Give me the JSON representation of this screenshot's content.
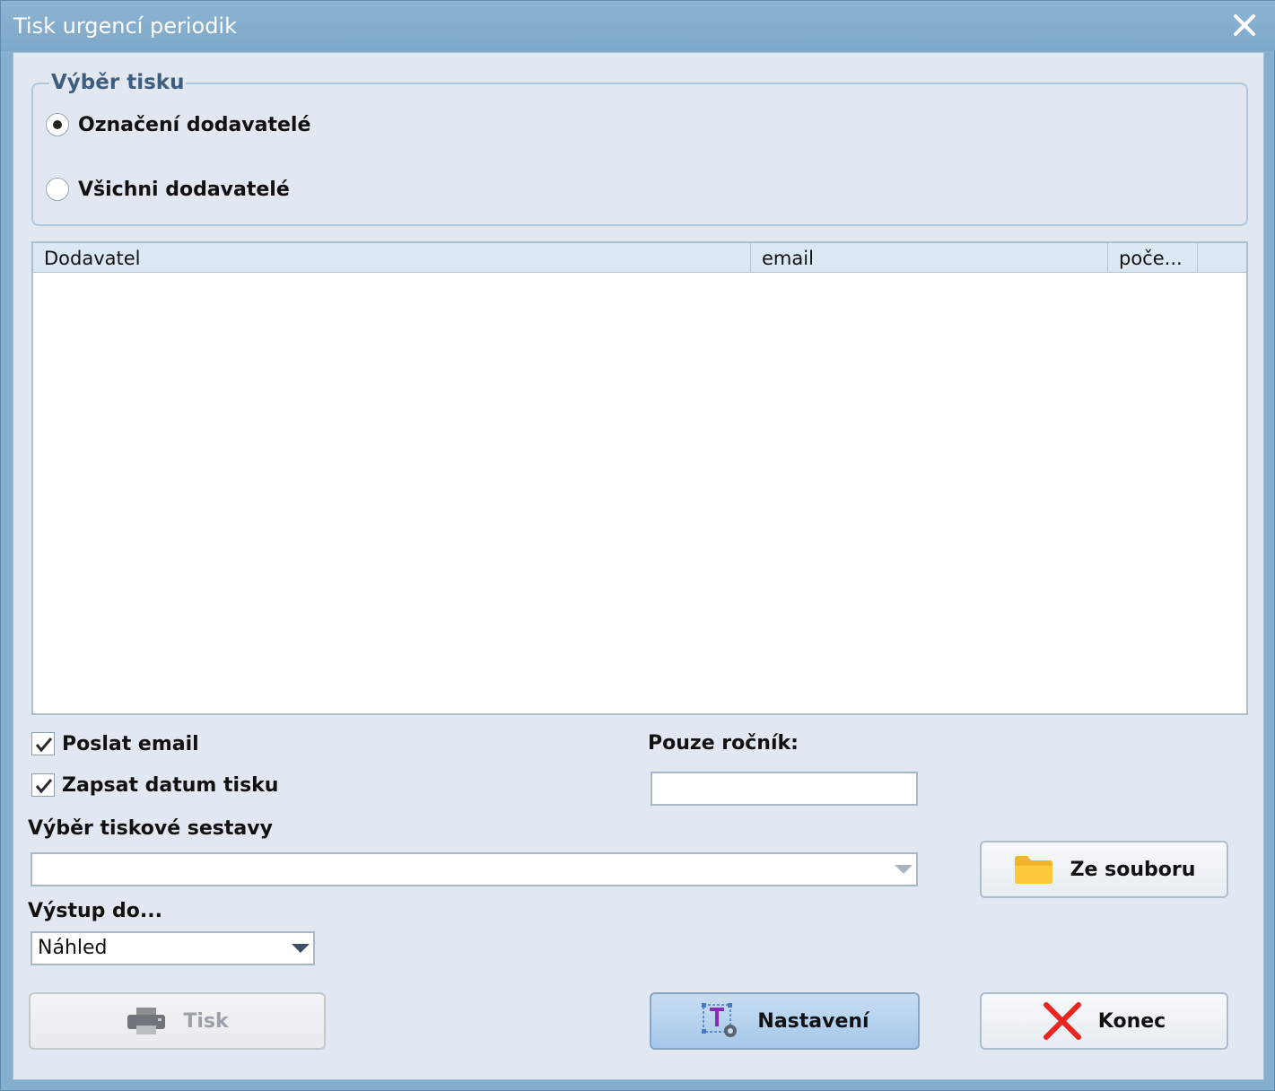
{
  "window": {
    "title": "Tisk urgencí periodik"
  },
  "print_selection": {
    "legend": "Výběr tisku",
    "options": [
      {
        "label": "Označení dodavatelé",
        "selected": true
      },
      {
        "label": "Všichni  dodavatelé",
        "selected": false
      }
    ]
  },
  "grid": {
    "columns": [
      "Dodavatel",
      "email",
      "poče...",
      ""
    ],
    "rows": []
  },
  "options": {
    "send_email_label": "Poslat email",
    "send_email_checked": true,
    "write_date_label": "Zapsat datum tisku",
    "write_date_checked": true,
    "year_only_label": "Pouze ročník:",
    "year_only_value": ""
  },
  "report": {
    "label": "Výběr tiskové sestavy",
    "value": "",
    "from_file_label": "Ze souboru"
  },
  "output": {
    "label": "Výstup do...",
    "value": "Náhled"
  },
  "buttons": {
    "print_label": "Tisk",
    "settings_label": "Nastavení",
    "close_label": "Konec"
  }
}
